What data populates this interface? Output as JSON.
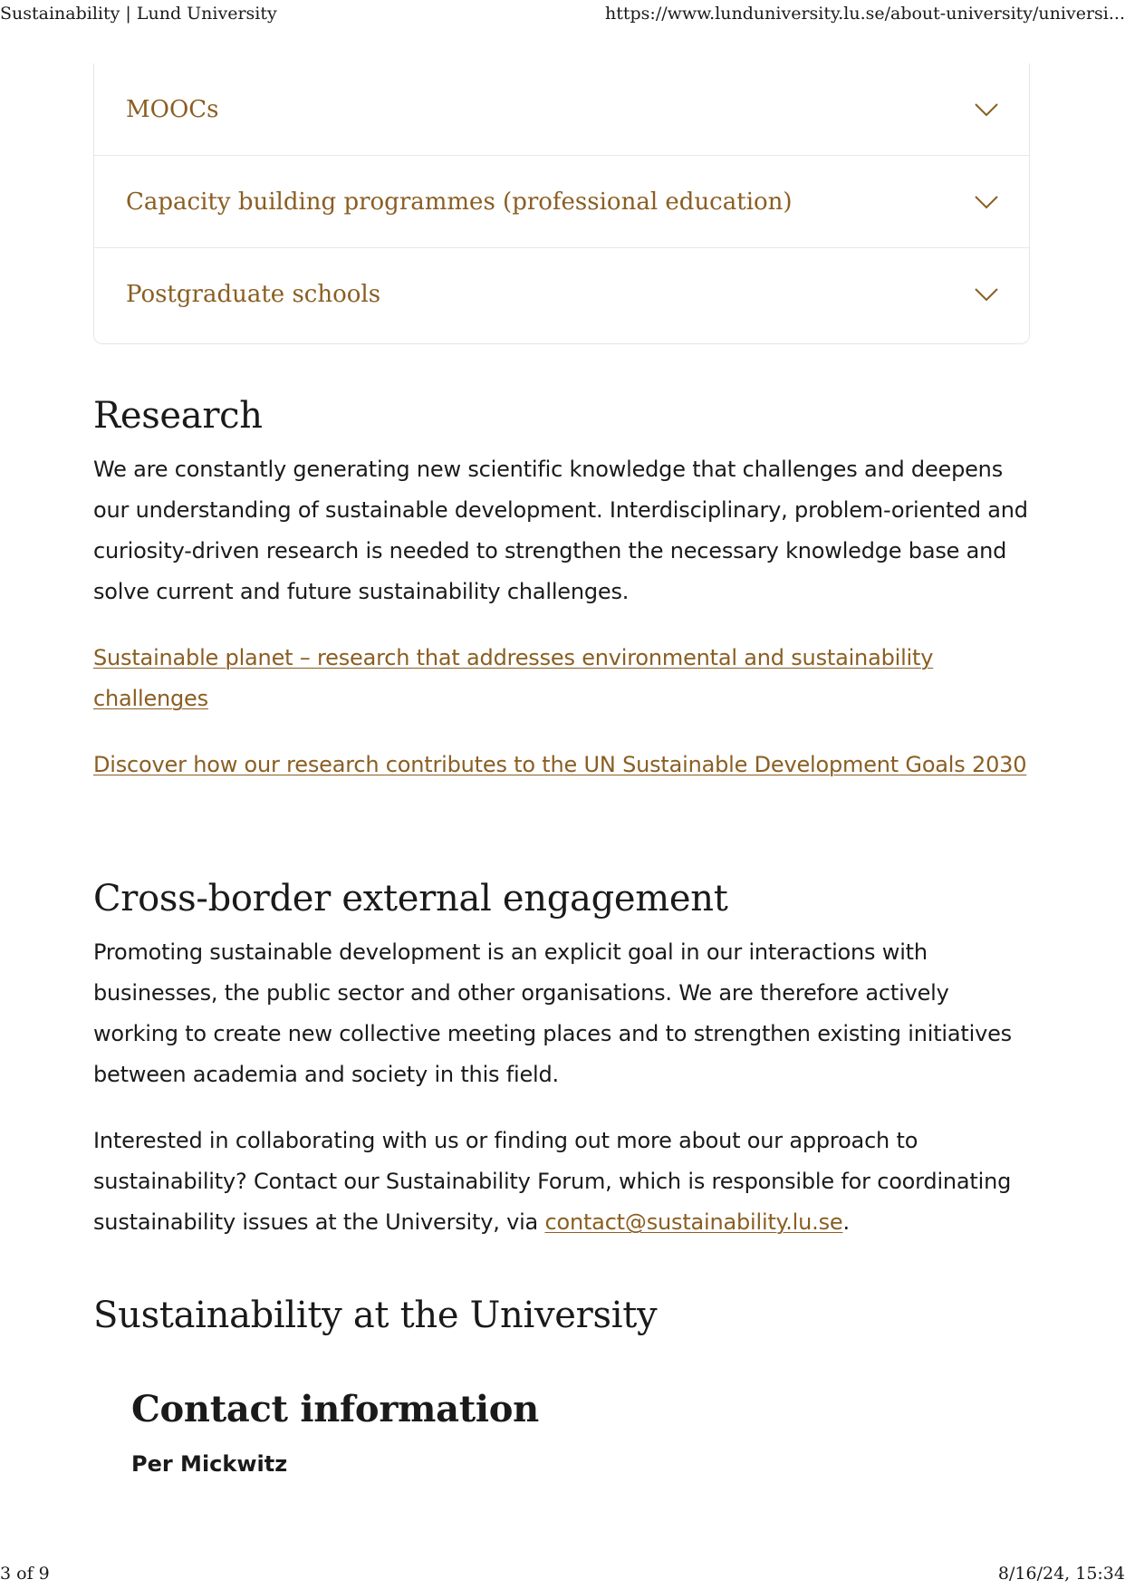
{
  "print_header": {
    "title": "Sustainability | Lund University",
    "url": "https://www.lunduniversity.lu.se/about-university/universi..."
  },
  "accordion": {
    "items": [
      {
        "label": "MOOCs"
      },
      {
        "label": "Capacity building programmes (professional education)"
      },
      {
        "label": "Postgraduate schools"
      }
    ],
    "accent_color": "#8a5e22"
  },
  "research": {
    "heading": "Research",
    "body": "We are constantly generating new scientific knowledge that challenges and deepens our understanding of sustainable development. Interdisciplinary, problem-oriented and curiosity-driven research is needed to strengthen the necessary knowledge base and solve current and future sustainability challenges.",
    "link1": "Sustainable planet – research that addresses environmental and sustainability challenges",
    "link2": "Discover how our research contributes to the UN Sustainable Development Goals 2030"
  },
  "engagement": {
    "heading": "Cross-border external engagement",
    "body1": "Promoting sustainable development is an explicit goal in our interactions with businesses, the public sector and other organisations. We are therefore actively working to create new collective meeting places and to strengthen existing initiatives between academia and society in this field.",
    "body2_prefix": "Interested in collaborating with us or finding out more about our approach to sustainability? Contact our Sustainability Forum, which is responsible for coordinating sustainability issues at the University, via ",
    "email": "contact@sustainability.lu.se",
    "body2_suffix": "."
  },
  "sustainability": {
    "heading": "Sustainability at the University"
  },
  "contact": {
    "heading": "Contact information",
    "name": "Per Mickwitz"
  },
  "print_footer": {
    "page": "3 of 9",
    "datetime": "8/16/24, 15:34"
  }
}
